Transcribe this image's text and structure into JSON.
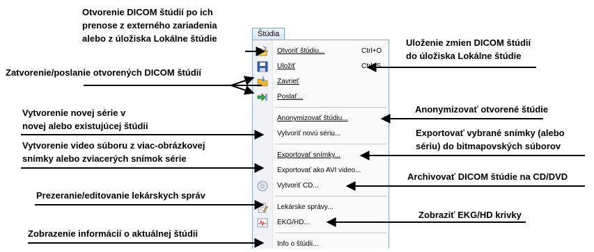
{
  "menu": {
    "title": "Štúdia",
    "items": [
      {
        "label": "Otvoriť štúdiu...",
        "shortcut": "Ctrl+O",
        "icon": "open-folder-icon"
      },
      {
        "label": "Uložiť",
        "shortcut": "Ctrl+S",
        "icon": "save-disk-icon"
      },
      {
        "label": "Zavrieť",
        "icon": "close-folder-icon"
      },
      {
        "label": "Poslať...",
        "icon": "send-icon"
      },
      {
        "label": "Anonymizovať štúdiu..."
      },
      {
        "label": "Vytvoriť novú sériu..."
      },
      {
        "label": "Exportovať snímky..."
      },
      {
        "label": "Exportovať ako AVI video..."
      },
      {
        "label": "Vytvoriť CD...",
        "icon": "cd-icon"
      },
      {
        "label": "Lekárske správy...",
        "icon": "report-icon"
      },
      {
        "label": "EKG/HD...",
        "icon": "ecg-icon"
      },
      {
        "label": "Info o štúdii..."
      }
    ]
  },
  "annotations": {
    "open_1": "Otvorenie DICOM štúdií po ich",
    "open_2": "prenose z externého zariadenia",
    "open_3": "alebo z úložiska Lokálne štúdie",
    "close_send": "Zatvorenie/poslanie otvorených DICOM štúdií",
    "newseries_1": "Vytvorenie novej série v",
    "newseries_2": "novej alebo existujúcej štúdii",
    "video_1": "Vytvorenie video súboru z viac-obrázkovej",
    "video_2": "snímky alebo zviacerých  snímok série",
    "reports": "Prezeranie/editovanie lekárskych správ",
    "info": "Zobrazenie informácií o aktuálnej štúdii",
    "save_1": "Uloženie zmien DICOM štúdií",
    "save_2": "do úložiska Lokálne štúdie",
    "anon": "Anonymizovať otvorené štúdie",
    "export_1": "Exportovať vybrané snímky (alebo",
    "export_2": "sériu) do bitmapovských súborov",
    "cd": "Archivovať DICOM štúdie na CD/DVD",
    "ekg": "Zobraziť EKG/HD krivky"
  }
}
